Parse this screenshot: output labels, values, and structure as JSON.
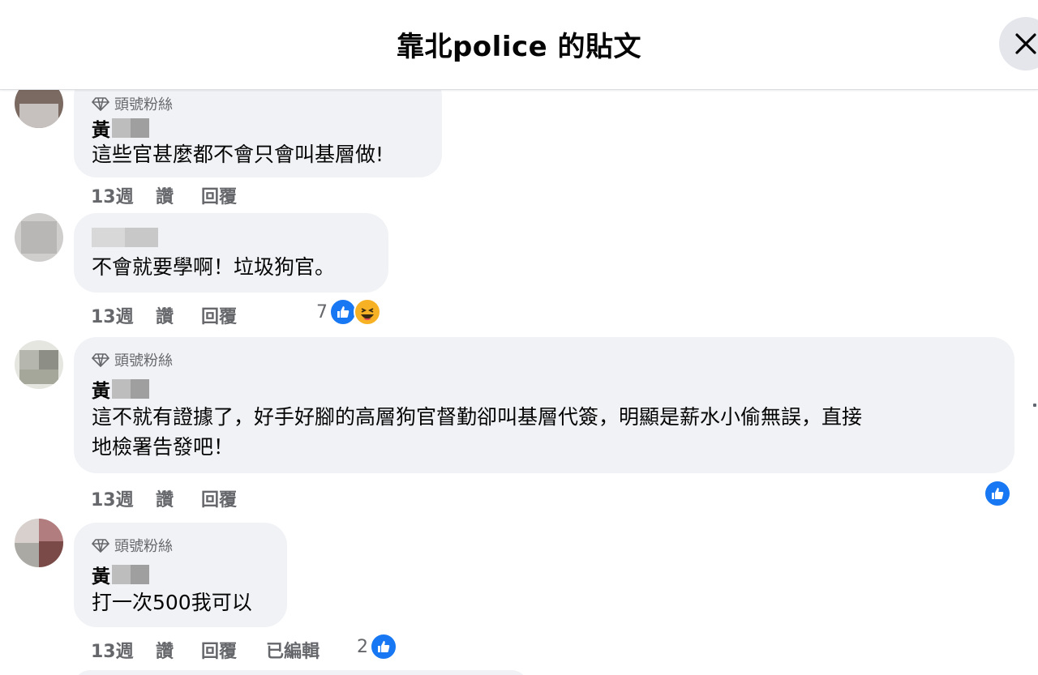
{
  "header": {
    "title": "靠北police 的貼文"
  },
  "comments": [
    {
      "badge": "頭號粉絲",
      "author_initial": "黃",
      "text": "這些官甚麼都不會只會叫基層做!",
      "time": "13週",
      "like": "讚",
      "reply": "回覆"
    },
    {
      "text": "不會就要學啊！垃圾狗官。",
      "time": "13週",
      "like": "讚",
      "reply": "回覆",
      "reaction_count": "7"
    },
    {
      "badge": "頭號粉絲",
      "author_initial": "黃",
      "text_line1": "這不就有證據了，好手好腳的高層狗官督勤卻叫基層代簽，明顯是薪水小偷無誤，直接",
      "text_line2": "地檢署告發吧！",
      "time": "13週",
      "like": "讚",
      "reply": "回覆"
    },
    {
      "badge": "頭號粉絲",
      "author_initial": "黃",
      "text": "打一次500我可以",
      "time": "13週",
      "like": "讚",
      "reply": "回覆",
      "edited": "已編輯",
      "reaction_count": "2"
    }
  ],
  "colors": {
    "like_blue": "#1877f2",
    "bubble_bg": "#f0f2f5",
    "meta_gray": "#65676b"
  }
}
